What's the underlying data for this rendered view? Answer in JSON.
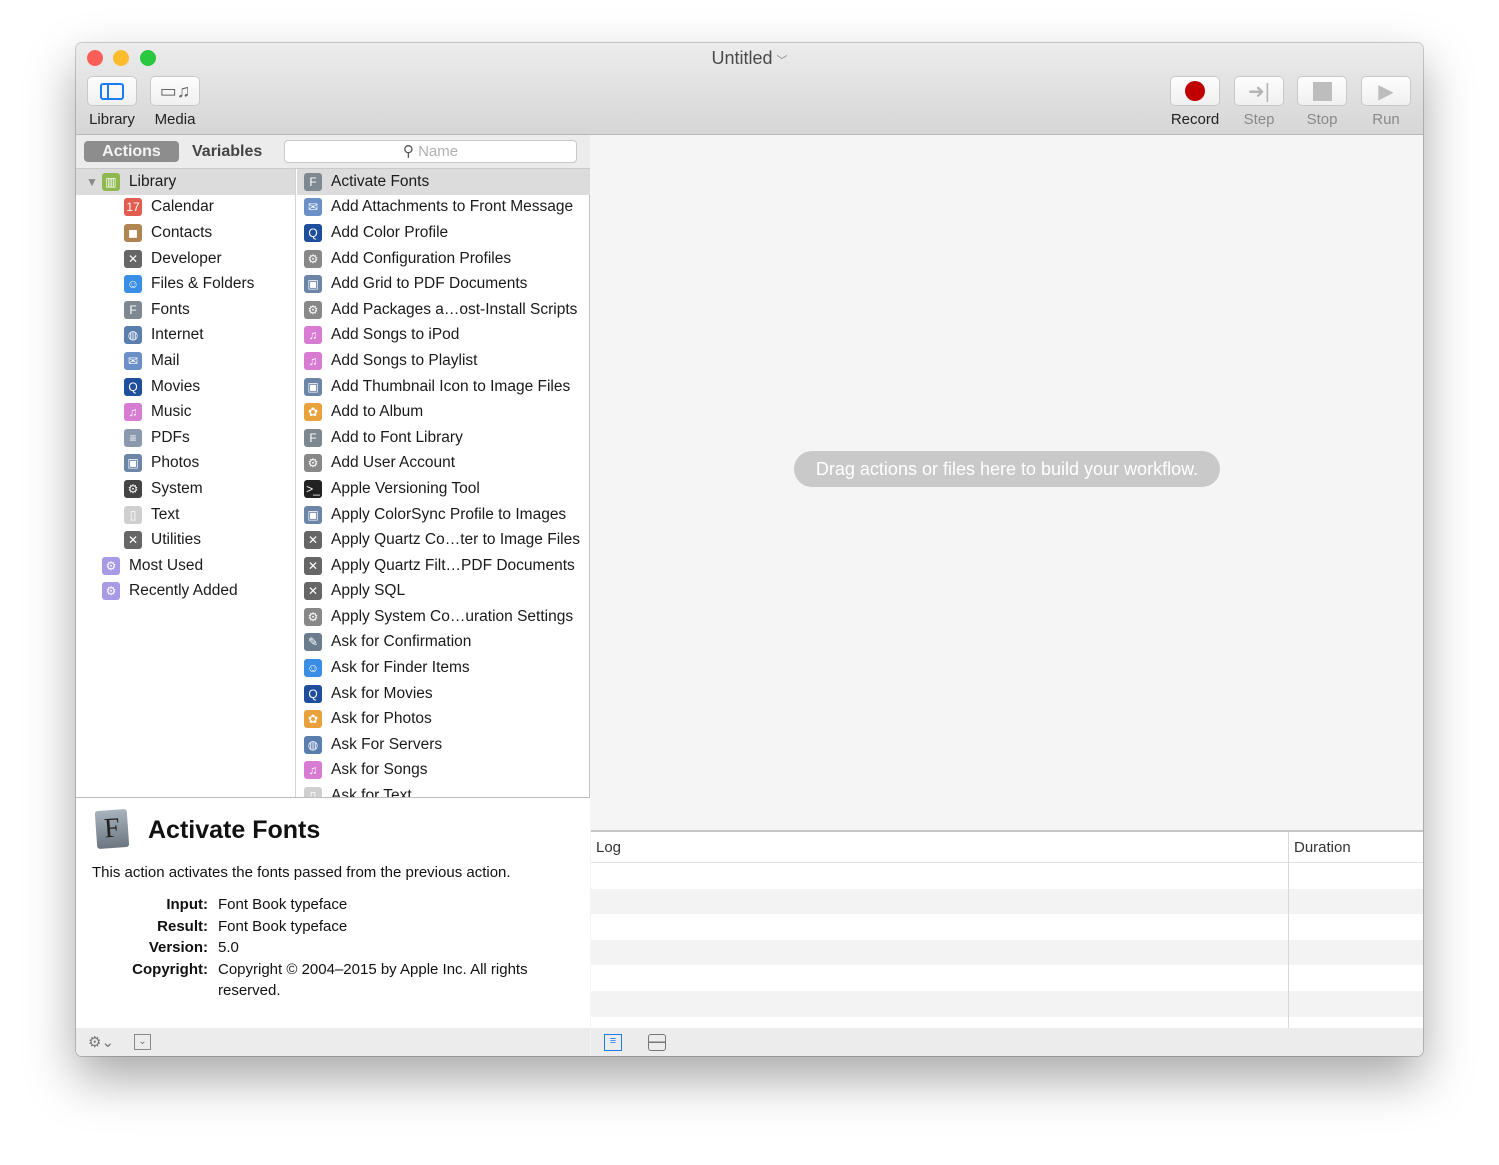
{
  "window": {
    "title": "Untitled"
  },
  "toolbar": {
    "library": "Library",
    "media": "Media",
    "record": "Record",
    "step": "Step",
    "stop": "Stop",
    "run": "Run"
  },
  "tabs": {
    "actions": "Actions",
    "variables": "Variables",
    "search_placeholder": "Name"
  },
  "categories": [
    {
      "label": "Library",
      "icon": "library-icon",
      "color": "#8fb84f",
      "glyph": "▥",
      "level": 0
    },
    {
      "label": "Calendar",
      "icon": "calendar-icon",
      "color": "#e25c4f",
      "glyph": "17",
      "level": 1
    },
    {
      "label": "Contacts",
      "icon": "contacts-icon",
      "color": "#b08551",
      "glyph": "◼",
      "level": 1
    },
    {
      "label": "Developer",
      "icon": "tools-icon",
      "color": "#666",
      "glyph": "✕",
      "level": 1
    },
    {
      "label": "Files & Folders",
      "icon": "finder-icon",
      "color": "#3a8ee6",
      "glyph": "☺",
      "level": 1
    },
    {
      "label": "Fonts",
      "icon": "font-icon",
      "color": "#7d8891",
      "glyph": "F",
      "level": 1
    },
    {
      "label": "Internet",
      "icon": "globe-icon",
      "color": "#5a7fae",
      "glyph": "◍",
      "level": 1
    },
    {
      "label": "Mail",
      "icon": "mail-icon",
      "color": "#6b8fc7",
      "glyph": "✉",
      "level": 1
    },
    {
      "label": "Movies",
      "icon": "quicktime-icon",
      "color": "#1f4f9c",
      "glyph": "Q",
      "level": 1
    },
    {
      "label": "Music",
      "icon": "music-icon",
      "color": "#d77bd3",
      "glyph": "♫",
      "level": 1
    },
    {
      "label": "PDFs",
      "icon": "pdf-icon",
      "color": "#8a99ae",
      "glyph": "≡",
      "level": 1
    },
    {
      "label": "Photos",
      "icon": "photos-icon",
      "color": "#6d86a8",
      "glyph": "▣",
      "level": 1
    },
    {
      "label": "System",
      "icon": "system-icon",
      "color": "#444",
      "glyph": "⚙",
      "level": 1
    },
    {
      "label": "Text",
      "icon": "text-icon",
      "color": "#cfcfcf",
      "glyph": "▯",
      "level": 1
    },
    {
      "label": "Utilities",
      "icon": "utilities-icon",
      "color": "#666",
      "glyph": "✕",
      "level": 1
    },
    {
      "label": "Most Used",
      "icon": "smart-folder-icon",
      "color": "#a99ae6",
      "glyph": "⚙",
      "level": 0
    },
    {
      "label": "Recently Added",
      "icon": "smart-folder-icon",
      "color": "#a99ae6",
      "glyph": "⚙",
      "level": 0
    }
  ],
  "actions": [
    {
      "label": "Activate Fonts",
      "color": "#7d8891",
      "glyph": "F"
    },
    {
      "label": "Add Attachments to Front Message",
      "color": "#6b8fc7",
      "glyph": "✉"
    },
    {
      "label": "Add Color Profile",
      "color": "#1f4f9c",
      "glyph": "Q"
    },
    {
      "label": "Add Configuration Profiles",
      "color": "#888",
      "glyph": "⚙"
    },
    {
      "label": "Add Grid to PDF Documents",
      "color": "#6d86a8",
      "glyph": "▣"
    },
    {
      "label": "Add Packages a…ost-Install Scripts",
      "color": "#888",
      "glyph": "⚙"
    },
    {
      "label": "Add Songs to iPod",
      "color": "#d77bd3",
      "glyph": "♫"
    },
    {
      "label": "Add Songs to Playlist",
      "color": "#d77bd3",
      "glyph": "♫"
    },
    {
      "label": "Add Thumbnail Icon to Image Files",
      "color": "#6d86a8",
      "glyph": "▣"
    },
    {
      "label": "Add to Album",
      "color": "#e9a23b",
      "glyph": "✿"
    },
    {
      "label": "Add to Font Library",
      "color": "#7d8891",
      "glyph": "F"
    },
    {
      "label": "Add User Account",
      "color": "#888",
      "glyph": "⚙"
    },
    {
      "label": "Apple Versioning Tool",
      "color": "#222",
      "glyph": ">_"
    },
    {
      "label": "Apply ColorSync Profile to Images",
      "color": "#6d86a8",
      "glyph": "▣"
    },
    {
      "label": "Apply Quartz Co…ter to Image Files",
      "color": "#666",
      "glyph": "✕"
    },
    {
      "label": "Apply Quartz Filt…PDF Documents",
      "color": "#666",
      "glyph": "✕"
    },
    {
      "label": "Apply SQL",
      "color": "#666",
      "glyph": "✕"
    },
    {
      "label": "Apply System Co…uration Settings",
      "color": "#888",
      "glyph": "⚙"
    },
    {
      "label": "Ask for Confirmation",
      "color": "#6b7c8f",
      "glyph": "✎"
    },
    {
      "label": "Ask for Finder Items",
      "color": "#3a8ee6",
      "glyph": "☺"
    },
    {
      "label": "Ask for Movies",
      "color": "#1f4f9c",
      "glyph": "Q"
    },
    {
      "label": "Ask for Photos",
      "color": "#e9a23b",
      "glyph": "✿"
    },
    {
      "label": "Ask For Servers",
      "color": "#5a7fae",
      "glyph": "◍"
    },
    {
      "label": "Ask for Songs",
      "color": "#d77bd3",
      "glyph": "♫"
    },
    {
      "label": "Ask for Text",
      "color": "#cfcfcf",
      "glyph": "▯"
    }
  ],
  "description": {
    "title": "Activate Fonts",
    "text": "This action activates the fonts passed from the previous action.",
    "fields": [
      {
        "k": "Input:",
        "v": "Font Book typeface"
      },
      {
        "k": "Result:",
        "v": "Font Book typeface"
      },
      {
        "k": "Version:",
        "v": "5.0"
      },
      {
        "k": "Copyright:",
        "v": "Copyright © 2004–2015 by Apple Inc. All rights reserved."
      }
    ]
  },
  "workflow": {
    "hint": "Drag actions or files here to build your workflow."
  },
  "log": {
    "col_log": "Log",
    "col_duration": "Duration"
  },
  "colors": {
    "record": "#c00000",
    "accent": "#1a7cf5"
  }
}
